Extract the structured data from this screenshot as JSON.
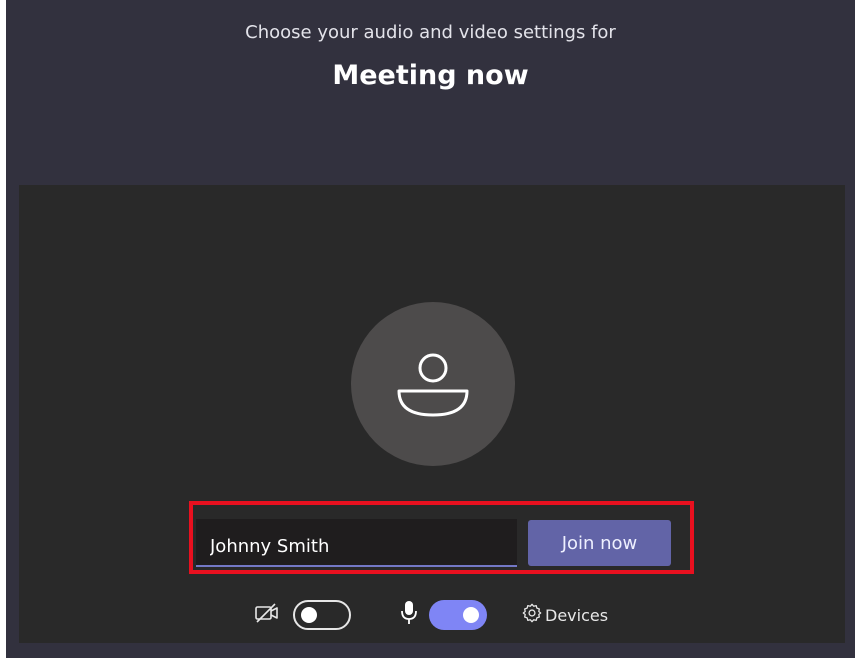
{
  "header": {
    "subtitle": "Choose your audio and video settings for",
    "meeting_title": "Meeting now"
  },
  "join_form": {
    "name_value": "Johnny Smith",
    "join_label": "Join now"
  },
  "controls": {
    "camera_toggle_state": "off",
    "mic_toggle_state": "on",
    "devices_label": "Devices"
  },
  "colors": {
    "background": "#32313e",
    "preview": "#292929",
    "accent": "#6264a7",
    "toggle_on": "#7f85f5",
    "highlight": "#e8101f"
  },
  "icons": {
    "avatar": "person-icon",
    "camera": "camera-off-icon",
    "mic": "microphone-icon",
    "devices": "gear-icon"
  }
}
